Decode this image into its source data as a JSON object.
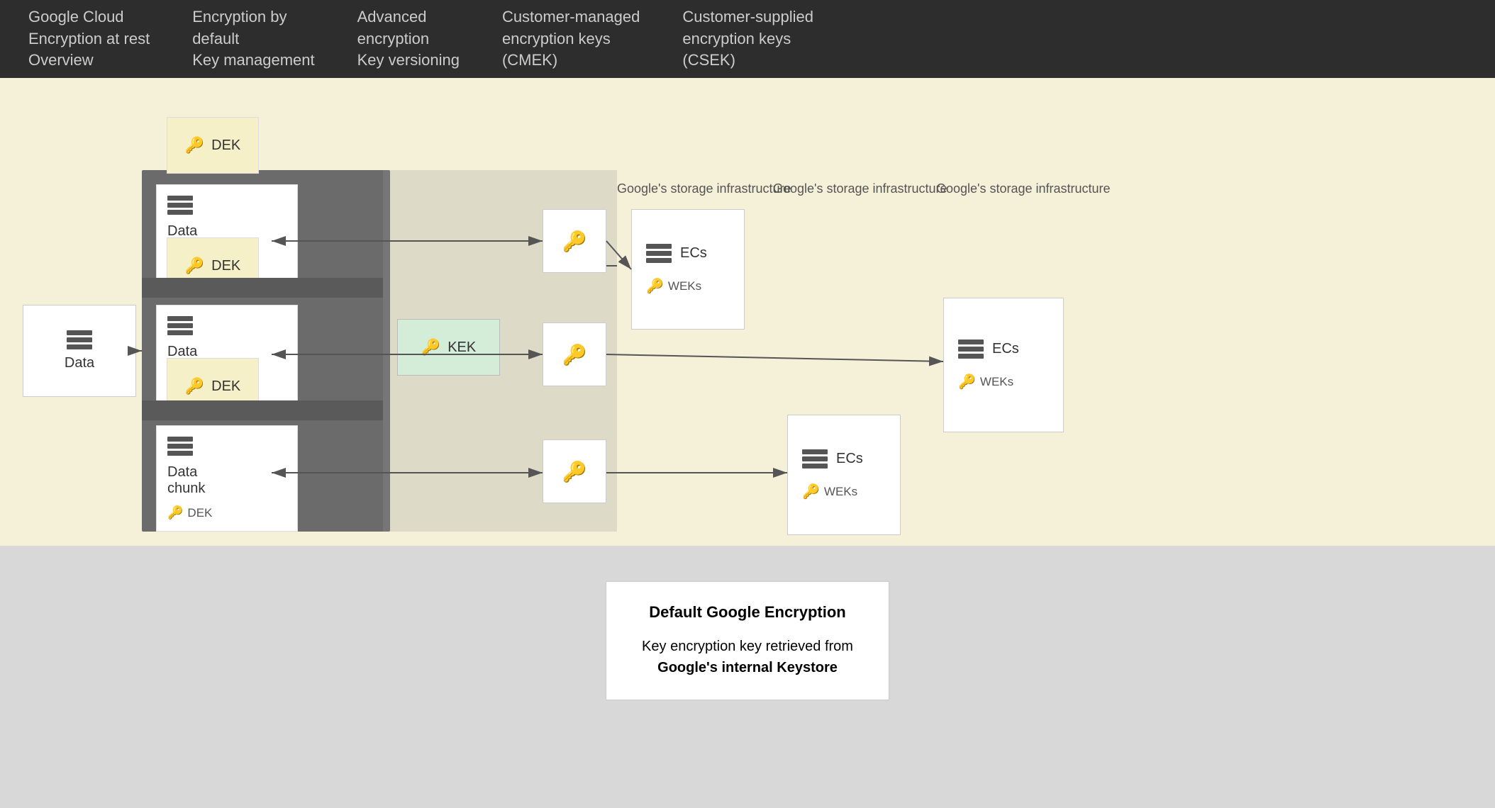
{
  "topbar": {
    "items": [
      {
        "text": "Google Cloud\nEncryption at rest\nOverview"
      },
      {
        "text": "Encryption by\ndefault\nKey management"
      },
      {
        "text": "Advanced\nencryption\nKey versioning"
      },
      {
        "text": "Customer-managed\nencryption keys\n(CMEK)"
      },
      {
        "text": "Customer-supplied\nencryption keys\n(CSEK)"
      }
    ]
  },
  "diagram": {
    "data_label": "Data",
    "chunk_label": "Data\nchunk",
    "dek_label": "DEK",
    "kek_label": "KEK",
    "ecs_label": "ECs",
    "weks_label": "WEKs",
    "infra_label_1": "Google's storage\ninfrastructure",
    "infra_label_2": "Google's storage\ninfrastructure",
    "infra_label_3": "Google's storage\ninfrastructure"
  },
  "legend": {
    "title": "Default Google Encryption",
    "description": "Key encryption key retrieved from",
    "bold_text": "Google's internal Keystore"
  }
}
